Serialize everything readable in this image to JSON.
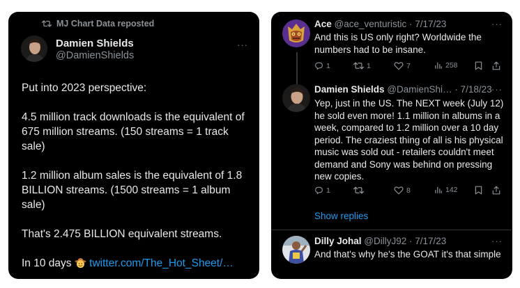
{
  "left_tweet": {
    "repost_label": "MJ Chart Data reposted",
    "author_name": "Damien Shields",
    "author_handle": "@DamienShields",
    "more": "···",
    "paragraphs": [
      "Put into 2023 perspective:",
      "4.5 million track downloads is the equivalent of 675 million streams. (150 streams = 1 track sale)",
      "1.2 million album sales is the equivalent of 1.8 BILLION streams. (1500 streams = 1 album sale)",
      "That's 2.475 BILLION equivalent streams."
    ],
    "last_line_prefix": "In 10 days",
    "last_line_link": "twitter.com/The_Hot_Sheet/…"
  },
  "replies": [
    {
      "name": "Ace",
      "handle": "@ace_venturistic",
      "date": "· 7/17/23",
      "text": "And this is US only right? Worldwide the numbers had to be insane.",
      "stats": {
        "replies": "1",
        "reposts": "1",
        "likes": "7",
        "views": "258"
      }
    },
    {
      "name": "Damien Shields",
      "handle": "@DamienShi…",
      "date": "· 7/18/23",
      "text": "Yep, just in the US. The NEXT week (July 12) he sold even more! 1.1 million in albums in a week, compared to 1.2 million over a 10 day period. The craziest thing of all is his physical music was sold out - retailers couldn't meet demand and Sony was behind on pressing new copies.",
      "stats": {
        "replies": "1",
        "reposts": "",
        "likes": "8",
        "views": "142"
      }
    },
    {
      "name": "Dilly Johal",
      "handle": "@DillyJ92",
      "date": "· 7/17/23",
      "text": "And that's why he's the GOAT it's that simple"
    }
  ],
  "show_replies": "Show replies",
  "colors": {
    "background": "#000000",
    "text": "#e7e9ea",
    "muted": "#8b9298",
    "link": "#1d9bf0"
  }
}
